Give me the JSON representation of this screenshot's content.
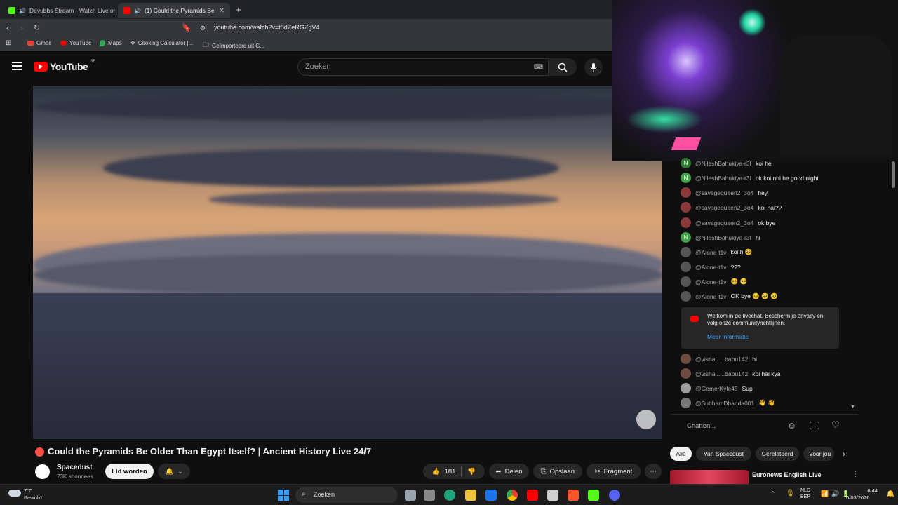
{
  "tabs": [
    {
      "title": "Devubbs Stream - Watch Live on",
      "favicon_color": "#53fc18"
    },
    {
      "title": "(1)  Could the Pyramids Be",
      "favicon_color": "#ff0000"
    }
  ],
  "address": {
    "url": "youtube.com/watch?v=t8dZeRGZgV4"
  },
  "bookmarks": [
    {
      "label": "Gmail"
    },
    {
      "label": "YouTube"
    },
    {
      "label": "Maps"
    },
    {
      "label": "Cooking Calculator |..."
    },
    {
      "label": "Geïmporteerd uit G..."
    }
  ],
  "yt_header": {
    "logo": "YouTube",
    "region": "BE",
    "search_placeholder": "Zoeken"
  },
  "chat": {
    "messages": [
      {
        "author": "@NileshBahukiya-r3f",
        "text": "koi he",
        "initial": "N",
        "color": "#2e7d32"
      },
      {
        "author": "@NileshBahukiya-r3f",
        "text": "ok koi nhi he good night",
        "initial": "N",
        "color": "#43a047"
      },
      {
        "author": "@savagequeen2_3o4",
        "text": "hey",
        "initial": "",
        "color": "#8a3a3a"
      },
      {
        "author": "@savagequeen2_3o4",
        "text": "koi hai??",
        "initial": "",
        "color": "#8a3a3a"
      },
      {
        "author": "@savagequeen2_3o4",
        "text": "ok bye",
        "initial": "",
        "color": "#8a3a3a"
      },
      {
        "author": "@NileshBahukiya-r3f",
        "text": "hi",
        "initial": "N",
        "color": "#43a047"
      },
      {
        "author": "@Alone-t1v",
        "text": "koi h 🥺",
        "initial": "",
        "color": "#555"
      },
      {
        "author": "@Alone-t1v",
        "text": "???",
        "initial": "",
        "color": "#555"
      },
      {
        "author": "@Alone-t1v",
        "text": "🥺 🥺",
        "initial": "",
        "color": "#555"
      },
      {
        "author": "@Alone-t1v",
        "text": "OK bye 😣 🥺 🥺",
        "initial": "",
        "color": "#555"
      },
      {
        "author": "@vishal.....babu142",
        "text": "hi",
        "initial": "",
        "color": "#6d4c41"
      },
      {
        "author": "@vishal.....babu142",
        "text": "koi hai kya",
        "initial": "",
        "color": "#6d4c41"
      },
      {
        "author": "@GomerKyle45",
        "text": "Sup",
        "initial": "",
        "color": "#9e9e9e"
      },
      {
        "author": "@SubhamDhanda001",
        "text": "👋 👋",
        "initial": "",
        "color": "#777"
      }
    ],
    "notice_text": "Welkom in de livechat. Bescherm je privacy en volg onze communityrichtlijnen.",
    "notice_link": "Meer informatie",
    "input_placeholder": "Chatten..."
  },
  "video": {
    "title": "Could the Pyramids Be Older Than Egypt Itself? | Ancient History Live 24/7",
    "channel": "Spacedust",
    "subscribers": "73K abonnees",
    "join_label": "Lid worden",
    "likes": "181",
    "share_label": "Delen",
    "save_label": "Opslaan",
    "clip_label": "Fragment"
  },
  "filter_chips": [
    "Alle",
    "Van Spacedust",
    "Gerelateerd",
    "Voor jou"
  ],
  "recommended": {
    "title": "Euronews English Live"
  },
  "taskbar": {
    "weather_temp": "7°C",
    "weather_desc": "Bewolkt",
    "search_label": "Zoeken",
    "lang_top": "NLD",
    "lang_bottom": "BEP",
    "time": "6:44",
    "date": "10/03/2026"
  }
}
